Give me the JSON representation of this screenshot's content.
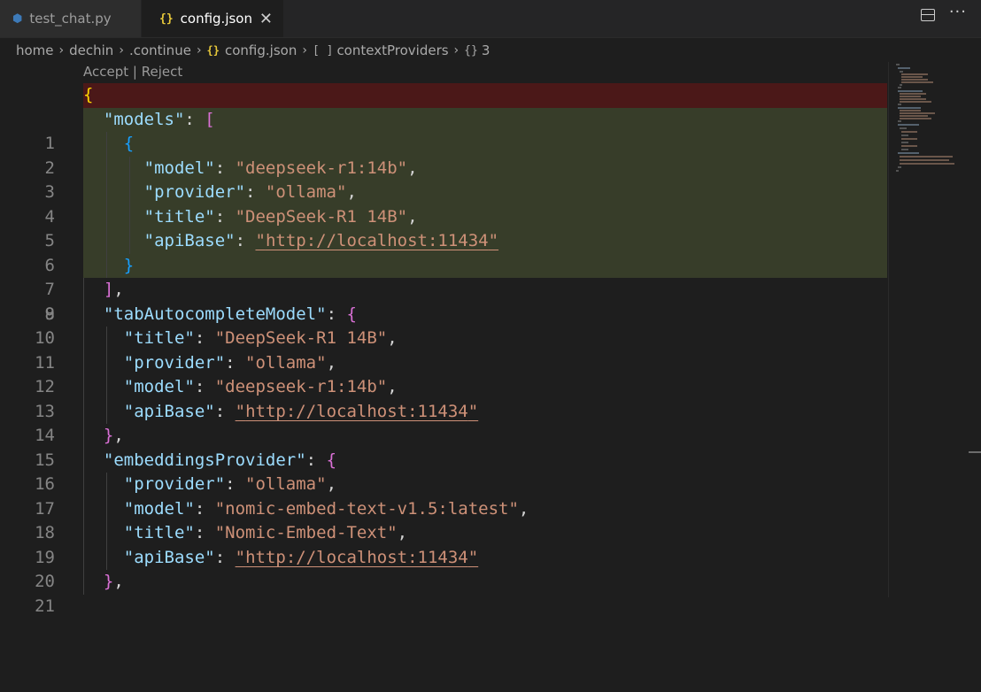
{
  "tabs": [
    {
      "label": "test_chat.py",
      "icon": "python-icon",
      "active": false
    },
    {
      "label": "config.json",
      "icon": "json-icon",
      "active": true
    }
  ],
  "tab_actions": {
    "more": "···"
  },
  "breadcrumb": {
    "items": [
      "home",
      "dechin",
      ".continue",
      "config.json",
      "contextProviders",
      "3"
    ],
    "json_glyph": "{}",
    "array_glyph": "[ ]",
    "object_glyph": "{}"
  },
  "codelens": {
    "accept": "Accept",
    "separator": " | ",
    "reject": "Reject"
  },
  "editor": {
    "line_numbers": [
      "1",
      "2",
      "3",
      "4",
      "5",
      "6",
      "7",
      "8",
      "9",
      "10",
      "11",
      "12",
      "13",
      "14",
      "15",
      "16",
      "17",
      "18",
      "19",
      "20",
      "21"
    ],
    "lines": {
      "l1": {
        "brace": "{"
      },
      "l2": {
        "key": "\"models\"",
        "colon": ": ",
        "open": "["
      },
      "l3": {
        "open": "{"
      },
      "l4": {
        "key": "\"model\"",
        "colon": ": ",
        "value": "\"deepseek-r1:14b\"",
        "comma": ","
      },
      "l5": {
        "key": "\"provider\"",
        "colon": ": ",
        "value": "\"ollama\"",
        "comma": ","
      },
      "l6": {
        "key": "\"title\"",
        "colon": ": ",
        "value": "\"DeepSeek-R1 14B\"",
        "comma": ","
      },
      "l7": {
        "key": "\"apiBase\"",
        "colon": ": ",
        "q1": "\"",
        "url": "http://localhost:11434",
        "q2": "\""
      },
      "l8": {
        "close": "}"
      },
      "l9": {
        "close": "]",
        "comma": ","
      },
      "l10": {
        "key": "\"tabAutocompleteModel\"",
        "colon": ": ",
        "open": "{"
      },
      "l11": {
        "key": "\"title\"",
        "colon": ": ",
        "value": "\"DeepSeek-R1 14B\"",
        "comma": ","
      },
      "l12": {
        "key": "\"provider\"",
        "colon": ": ",
        "value": "\"ollama\"",
        "comma": ","
      },
      "l13": {
        "key": "\"model\"",
        "colon": ": ",
        "value": "\"deepseek-r1:14b\"",
        "comma": ","
      },
      "l14": {
        "key": "\"apiBase\"",
        "colon": ": ",
        "q1": "\"",
        "url": "http://localhost:11434",
        "q2": "\""
      },
      "l15": {
        "close": "}",
        "comma": ","
      },
      "l16": {
        "key": "\"embeddingsProvider\"",
        "colon": ": ",
        "open": "{"
      },
      "l17": {
        "key": "\"provider\"",
        "colon": ": ",
        "value": "\"ollama\"",
        "comma": ","
      },
      "l18": {
        "key": "\"model\"",
        "colon": ": ",
        "value": "\"nomic-embed-text-v1.5:latest\"",
        "comma": ","
      },
      "l19": {
        "key": "\"title\"",
        "colon": ": ",
        "value": "\"Nomic-Embed-Text\"",
        "comma": ","
      },
      "l20": {
        "key": "\"apiBase\"",
        "colon": ": ",
        "q1": "\"",
        "url": "http://localhost:11434",
        "q2": "\""
      },
      "l21": {
        "close": "}",
        "comma": ","
      }
    }
  },
  "colors": {
    "deleted_line_bg": "#4b1818",
    "added_line_bg": "#373d29",
    "json_key": "#9cdcfe",
    "json_string": "#ce9178"
  }
}
